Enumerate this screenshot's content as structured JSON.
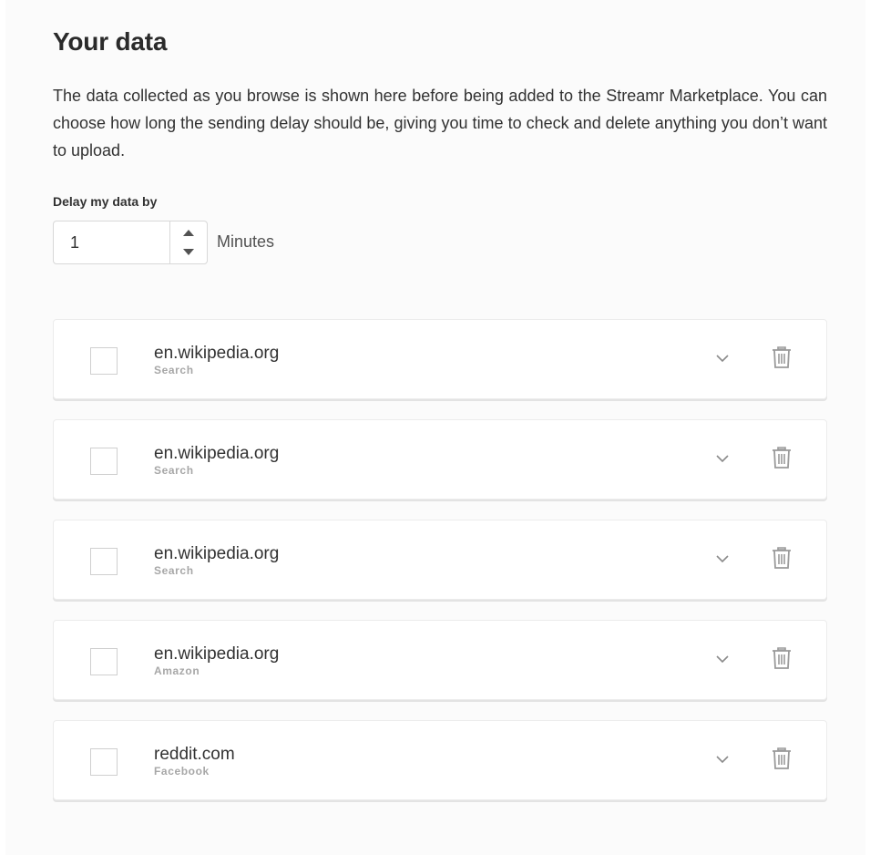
{
  "page": {
    "title": "Your data",
    "description": "The data collected as you browse is shown here before being added to the Streamr Marketplace. You can choose how long the sending delay should be, giving you time to check and delete anything you don’t want to upload."
  },
  "delay": {
    "label": "Delay my data by",
    "value": "1",
    "unit": "Minutes"
  },
  "items": [
    {
      "domain": "en.wikipedia.org",
      "source": "Search",
      "checked": false
    },
    {
      "domain": "en.wikipedia.org",
      "source": "Search",
      "checked": false
    },
    {
      "domain": "en.wikipedia.org",
      "source": "Search",
      "checked": false
    },
    {
      "domain": "en.wikipedia.org",
      "source": "Amazon",
      "checked": false
    },
    {
      "domain": "reddit.com",
      "source": "Facebook",
      "checked": false
    }
  ],
  "icons": {
    "stepper_up": "triangle-up-icon",
    "stepper_down": "triangle-down-icon",
    "expand": "chevron-down-icon",
    "delete": "trash-icon"
  },
  "colors": {
    "background": "#fbfbfb",
    "card": "#ffffff",
    "text": "#323232",
    "muted": "#a7a7a7",
    "icon": "#9a9a9a"
  }
}
